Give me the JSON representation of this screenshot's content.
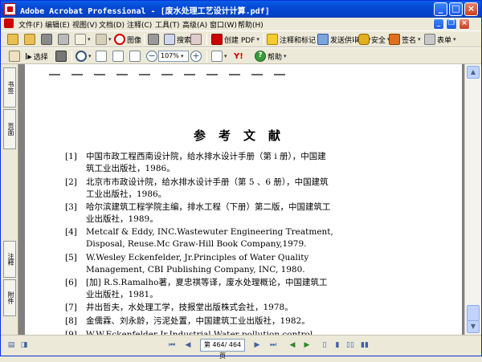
{
  "window": {
    "title": "Adobe Acrobat Professional - [废水处理工艺设计计算.pdf]",
    "colors": {
      "titlebar": "#0548d3",
      "accent_red": "#cc0000"
    }
  },
  "menu": [
    "文件(F)",
    "编辑(E)",
    "视图(V)",
    "文档(D)",
    "注释(C)",
    "工具(T)",
    "高级(A)",
    "窗口(W)",
    "帮助(H)"
  ],
  "toolbar1": {
    "file_icon_labels": [
      "open-icon",
      "create-icon",
      "save-icon",
      "print-icon",
      "email-icon",
      "attach-icon"
    ],
    "search_image_label": "图像",
    "search_label": "搜索",
    "create_pdf_label": "创建 PDF",
    "comment_label": "注释和标记",
    "review_label": "发送供审阅",
    "secure_label": "安全",
    "sign_label": "签名",
    "form_label": "表单"
  },
  "toolbar2": {
    "select_label": "选择",
    "zoom_value": "107%",
    "help_label": "帮助"
  },
  "left_tabs": {
    "bookmarks": "书签",
    "pages": "页面",
    "comments": "注释",
    "attachments": "附件"
  },
  "document": {
    "heading": "参考文献",
    "references": [
      {
        "num": "[1]",
        "lines": [
          "中国市政工程西南设计院，给水排水设计手册（第 i 册），中国建",
          "筑工业出版社，1986。"
        ]
      },
      {
        "num": "[2]",
        "lines": [
          "北京市市政设计院，给水排水设计手册（第 5 、6 册），中国建筑",
          "工业出版社，1986。"
        ]
      },
      {
        "num": "[3]",
        "lines": [
          "哈尔滨建筑工程学院主编，排水工程（下册）第二版，中国建筑工",
          "业出版社，1989。"
        ]
      },
      {
        "num": "[4]",
        "lines": [
          "Metcalf & Eddy, INC.Wastewuter Engineering Treatment,",
          "Disposal, Reuse.Mc Graw-Hill Book Company,1979."
        ]
      },
      {
        "num": "[5]",
        "lines": [
          "W.Wesley Eckenfelder, Jr.Principles  of  Water Quality",
          "Management, CBI Publishing Company, INC, 1980."
        ]
      },
      {
        "num": "[6]",
        "lines": [
          "[加] R.S.Ramalho著，夏忠祺等译，废水处理概论，中国建筑工",
          "业出版社，1981。"
        ]
      },
      {
        "num": "[7]",
        "lines": [
          "井出哲夫，水处理工学，技报堂出版株式会社，1978。"
        ]
      },
      {
        "num": "[8]",
        "lines": [
          "金儒霖、刘永龄，污泥处置，中国建筑工业出版社，1982。"
        ]
      },
      {
        "num": "[9]",
        "lines": [
          "W.W.Eckenfelder Jr.Industrial Water  pollution  control"
        ]
      }
    ]
  },
  "status": {
    "page_indicator": "第 464/ 464 页"
  }
}
